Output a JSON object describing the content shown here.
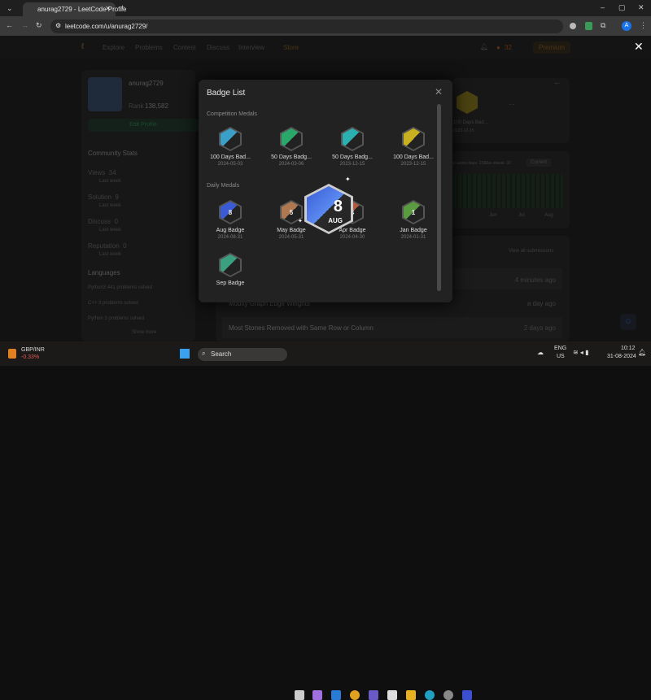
{
  "browser": {
    "tab_title": "anurag2729 - LeetCode Profile",
    "url": "leetcode.com/u/anurag2729/"
  },
  "nav": {
    "items": [
      "Explore",
      "Problems",
      "Contest",
      "Discuss",
      "Interview",
      "Store"
    ],
    "streak": "32",
    "premium": "Premium"
  },
  "profile": {
    "username": "anurag2729",
    "rank_label": "Rank",
    "rank": "138,582",
    "edit": "Edit Profile"
  },
  "community": {
    "title": "Community Stats",
    "stats": [
      {
        "label": "Views",
        "value": "34"
      },
      {
        "label": "Solution",
        "value": "9"
      },
      {
        "label": "Discuss",
        "value": "0"
      },
      {
        "label": "Reputation",
        "value": "0"
      }
    ],
    "last_week": "Last week"
  },
  "languages": {
    "title": "Languages",
    "items": [
      {
        "name": "Python3",
        "count": "441",
        "suffix": "problems solved"
      },
      {
        "name": "C++",
        "count": "3",
        "suffix": "problems solved"
      },
      {
        "name": "Python",
        "count": "3",
        "suffix": "problems solved"
      }
    ],
    "show_more": "Show more"
  },
  "background": {
    "badge_name": "100 Days Bad...",
    "badge_date": "2023-12-15",
    "days": "Total active days: 231",
    "max_streak": "Max streak: 32",
    "current": "Current",
    "months": [
      "Jun",
      "Jul",
      "Aug"
    ],
    "view_all": "View all submissions",
    "subs": [
      {
        "title": "",
        "time": "4 minutes ago"
      },
      {
        "title": "Modify Graph Edge Weights",
        "time": "a day ago"
      },
      {
        "title": "Most Stones Removed with Same Row or Column",
        "time": "2 days ago"
      }
    ]
  },
  "modal": {
    "title": "Badge List",
    "competition_label": "Competition Medals",
    "daily_label": "Daily Medals",
    "competition": [
      {
        "name": "100 Days Bad...",
        "date": "2024-05-03",
        "color": "#3aa0c8"
      },
      {
        "name": "50 Days Badg...",
        "date": "2024-03-06",
        "color": "#2aa86a"
      },
      {
        "name": "50 Days Badg...",
        "date": "2023-12-15",
        "color": "#2ab0b0"
      },
      {
        "name": "100 Days Bad...",
        "date": "2023-12-15",
        "color": "#c8b020"
      }
    ],
    "daily": [
      {
        "name": "Aug Badge",
        "date": "2024-08-31",
        "num": "8",
        "color": "#3b5bd6"
      },
      {
        "name": "May Badge",
        "date": "2024-05-31",
        "num": "5",
        "color": "#b07850"
      },
      {
        "name": "Apr Badge",
        "date": "2024-04-30",
        "num": "4",
        "color": "#b05a40"
      },
      {
        "name": "Jan Badge",
        "date": "2024-01-31",
        "num": "1",
        "color": "#5a9a40"
      },
      {
        "name": "Sep Badge",
        "date": "",
        "num": "",
        "color": "#3aa080"
      }
    ],
    "featured": {
      "num": "8",
      "month": "AUG"
    }
  },
  "taskbar": {
    "stock": "GBP/INR",
    "change": "-0.33%",
    "search": "Search",
    "lang1": "ENG",
    "lang2": "US",
    "time": "10:12",
    "date": "31-08-2024"
  }
}
